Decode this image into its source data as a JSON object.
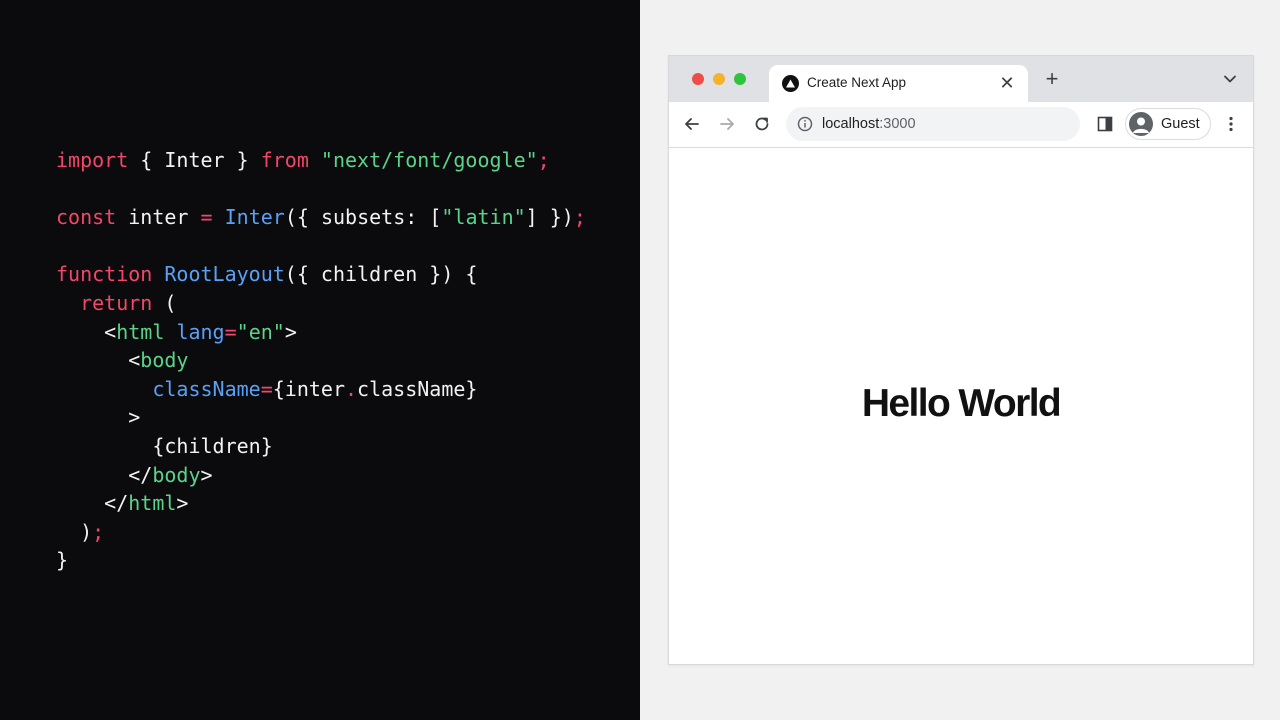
{
  "code": {
    "lines": [
      [
        {
          "t": "import",
          "c": "kw"
        },
        {
          "t": " { Inter } ",
          "c": "pl"
        },
        {
          "t": "from",
          "c": "kw"
        },
        {
          "t": " \"next/font/google\"",
          "c": "str"
        },
        {
          "t": ";",
          "c": "kw"
        }
      ],
      [],
      [
        {
          "t": "const",
          "c": "kw"
        },
        {
          "t": " inter ",
          "c": "pl"
        },
        {
          "t": "=",
          "c": "kw"
        },
        {
          "t": " ",
          "c": "pl"
        },
        {
          "t": "Inter",
          "c": "fn"
        },
        {
          "t": "({ subsets: [",
          "c": "pl"
        },
        {
          "t": "\"latin\"",
          "c": "str"
        },
        {
          "t": "] })",
          "c": "pl"
        },
        {
          "t": ";",
          "c": "kw"
        }
      ],
      [],
      [
        {
          "t": "function",
          "c": "kw"
        },
        {
          "t": " ",
          "c": "pl"
        },
        {
          "t": "RootLayout",
          "c": "fn"
        },
        {
          "t": "({ children }) {",
          "c": "pl"
        }
      ],
      [
        {
          "t": "  ",
          "c": "pl"
        },
        {
          "t": "return",
          "c": "kw"
        },
        {
          "t": " (",
          "c": "pl"
        }
      ],
      [
        {
          "t": "    <",
          "c": "pl"
        },
        {
          "t": "html",
          "c": "tag"
        },
        {
          "t": " ",
          "c": "pl"
        },
        {
          "t": "lang",
          "c": "attr"
        },
        {
          "t": "=",
          "c": "kw"
        },
        {
          "t": "\"en\"",
          "c": "str"
        },
        {
          "t": ">",
          "c": "pl"
        }
      ],
      [
        {
          "t": "      <",
          "c": "pl"
        },
        {
          "t": "body",
          "c": "tag"
        }
      ],
      [
        {
          "t": "        ",
          "c": "pl"
        },
        {
          "t": "className",
          "c": "attr"
        },
        {
          "t": "=",
          "c": "kw"
        },
        {
          "t": "{inter",
          "c": "pl"
        },
        {
          "t": ".",
          "c": "kw"
        },
        {
          "t": "className}",
          "c": "pl"
        }
      ],
      [
        {
          "t": "      >",
          "c": "pl"
        }
      ],
      [
        {
          "t": "        {children}",
          "c": "pl"
        }
      ],
      [
        {
          "t": "      </",
          "c": "pl"
        },
        {
          "t": "body",
          "c": "tag"
        },
        {
          "t": ">",
          "c": "pl"
        }
      ],
      [
        {
          "t": "    </",
          "c": "pl"
        },
        {
          "t": "html",
          "c": "tag"
        },
        {
          "t": ">",
          "c": "pl"
        }
      ],
      [
        {
          "t": "  )",
          "c": "pl"
        },
        {
          "t": ";",
          "c": "kw"
        }
      ],
      [
        {
          "t": "}",
          "c": "pl"
        }
      ]
    ]
  },
  "browser": {
    "tab": {
      "title": "Create Next App",
      "close_icon": "close-icon",
      "favicon": "nextjs-triangle-icon"
    },
    "new_tab_icon": "plus-icon",
    "address": {
      "host": "localhost",
      "port": ":3000",
      "icon": "info-icon"
    },
    "profile": {
      "label": "Guest",
      "icon": "avatar-icon"
    },
    "page": {
      "heading": "Hello World"
    }
  },
  "colors": {
    "keyword": "#f2476a",
    "string": "#5bd38a",
    "function": "#5aa0f5",
    "code_bg": "#0b0b0d",
    "page_bg": "#f1f1f2"
  }
}
